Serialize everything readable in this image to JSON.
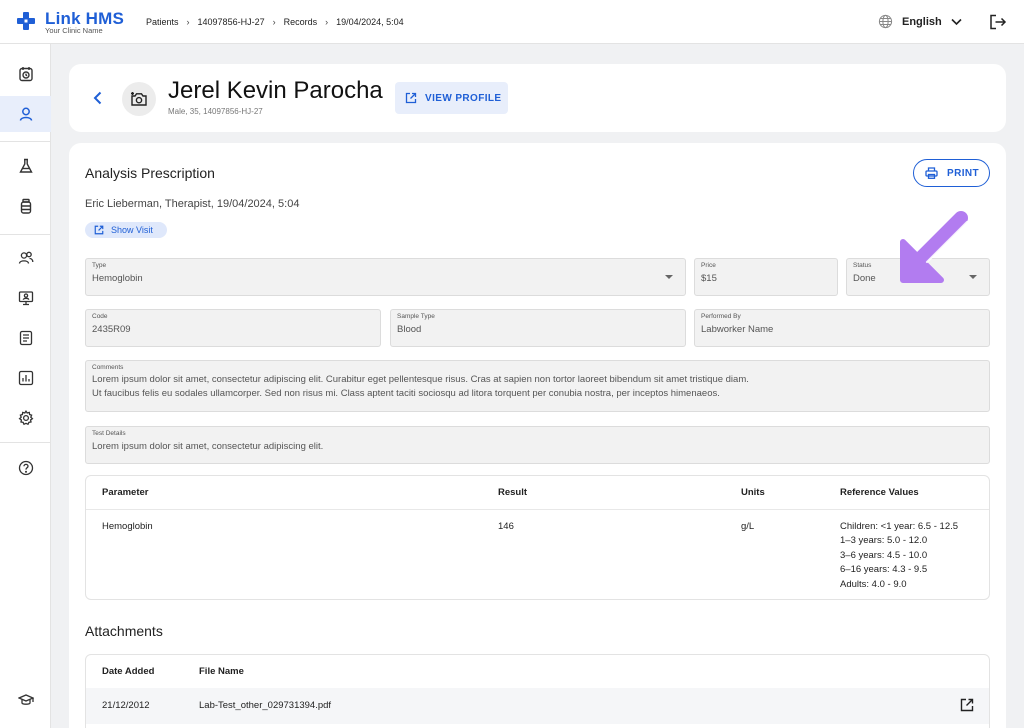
{
  "app": {
    "name": "Link HMS",
    "subtitle": "Your Clinic Name"
  },
  "breadcrumb": [
    "Patients",
    "14097856-HJ-27",
    "Records",
    "19/04/2024, 5:04"
  ],
  "language": "English",
  "sidebar_icons": [
    "calendar-icon",
    "user-icon",
    "flask-icon",
    "bottle-icon",
    "users-icon",
    "monitor-icon",
    "document-icon",
    "chart-icon",
    "gear-icon",
    "help-icon",
    "graduation-cap-icon"
  ],
  "patient": {
    "name": "Jerel Kevin Parocha",
    "details": "Male, 35, 14097856-HJ-27",
    "view_profile_label": "VIEW PROFILE"
  },
  "prescription": {
    "title": "Analysis Prescription",
    "print_label": "PRINT",
    "doctor_line": "Eric Lieberman, Therapist, 19/04/2024, 5:04",
    "show_visit_label": "Show Visit",
    "fields": {
      "type": {
        "label": "Type",
        "value": "Hemoglobin"
      },
      "price": {
        "label": "Price",
        "value": "$15"
      },
      "status": {
        "label": "Status",
        "value": "Done"
      },
      "code": {
        "label": "Code",
        "value": "2435R09"
      },
      "sample_type": {
        "label": "Sample Type",
        "value": "Blood"
      },
      "performed_by": {
        "label": "Performed By",
        "value": "Labworker Name"
      },
      "comments": {
        "label": "Comments",
        "line1": "Lorem ipsum dolor sit amet, consectetur adipiscing elit. Curabitur eget pellentesque risus. Cras at sapien non tortor laoreet bibendum sit amet tristique diam.",
        "line2": "Ut faucibus felis eu sodales ullamcorper. Sed non risus mi. Class aptent taciti sociosqu ad litora torquent per conubia nostra, per inceptos himenaeos."
      },
      "test_details": {
        "label": "Test Details",
        "value": "Lorem ipsum dolor sit amet, consectetur adipiscing elit."
      }
    },
    "results_table": {
      "headers": [
        "Parameter",
        "Result",
        "Units",
        "Reference Values"
      ],
      "row": {
        "parameter": "Hemoglobin",
        "result": "146",
        "units": "g/L",
        "reference": [
          "Children: <1 year: 6.5 - 12.5",
          "1–3 years: 5.0 - 12.0",
          "3–6 years: 4.5 - 10.0",
          "6–16 years: 4.3 - 9.5",
          "Adults: 4.0 - 9.0"
        ]
      }
    }
  },
  "attachments": {
    "title": "Attachments",
    "headers": [
      "Date Added",
      "File Name"
    ],
    "rows": [
      {
        "date": "21/12/2012",
        "file": "Lab-Test_other_029731394.pdf"
      }
    ]
  },
  "colors": {
    "primary": "#1f5fd6",
    "accent_light": "#e8eefb",
    "annotation_arrow": "#b27cf0",
    "background": "#f0f1f3"
  }
}
